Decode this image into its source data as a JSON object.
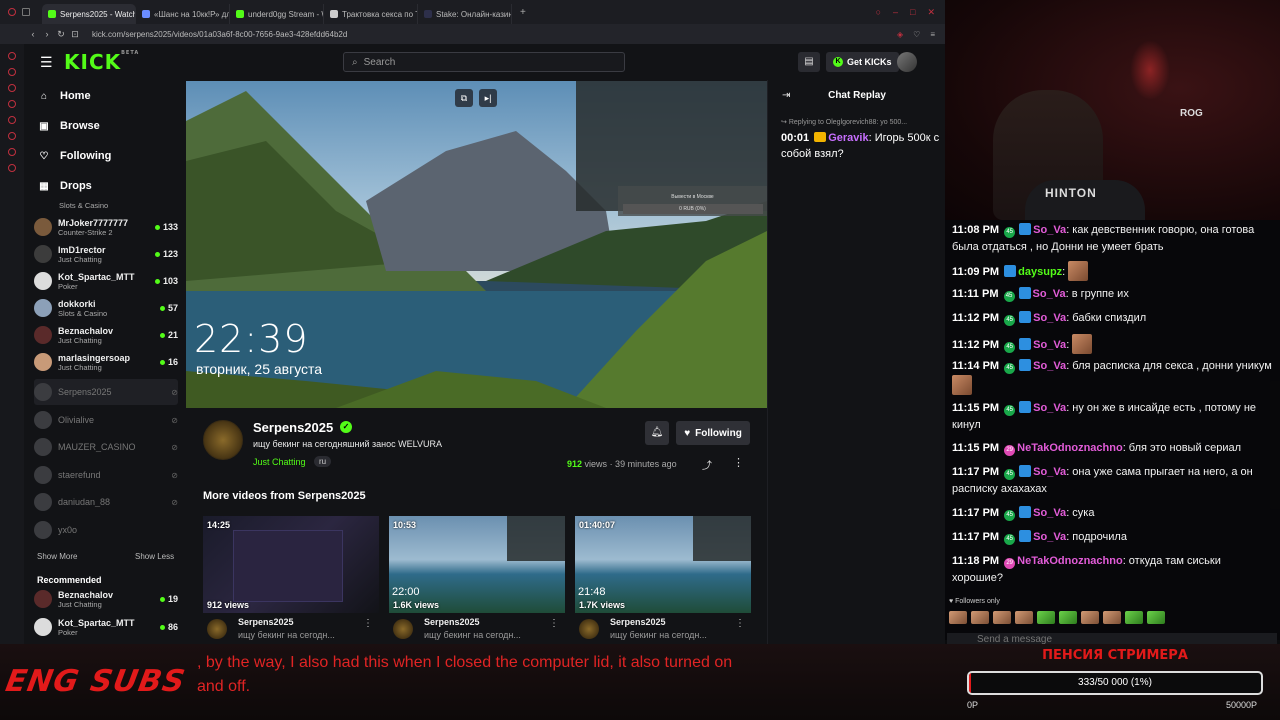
{
  "browser": {
    "tabs": [
      {
        "label": "Serpens2025 - Watch",
        "color": "#53fc18",
        "active": true
      },
      {
        "label": "«Шанс на 10кк!Р» для зрит",
        "color": "#6a8cff",
        "active": false
      },
      {
        "label": "underd0gg Stream - Watc",
        "color": "#53fc18",
        "active": false
      },
      {
        "label": "Трактовка секса по Таро",
        "color": "#cccccc",
        "active": false
      },
      {
        "label": "Stake: Онлайн-казино и с",
        "color": "#2d2f4a",
        "active": false
      }
    ],
    "new_tab": "+",
    "url": "kick.com/serpens2025/videos/01a03a6f-8c00-7656-9ae3-428efdd64b2d"
  },
  "header": {
    "logo": "KICK",
    "logo_sup": "BETA",
    "search_placeholder": "Search",
    "get_kicks": "Get KICKs"
  },
  "sidebar": {
    "nav": [
      {
        "label": "Home",
        "icon": "home-icon"
      },
      {
        "label": "Browse",
        "icon": "browse-icon"
      },
      {
        "label": "Following",
        "icon": "heart-icon"
      },
      {
        "label": "Drops",
        "icon": "drops-icon"
      }
    ],
    "top_partial_category": "Slots & Casino",
    "channels": [
      {
        "name": "MrJoker7777777",
        "category": "Counter-Strike 2",
        "viewers": "133"
      },
      {
        "name": "ImD1rector",
        "category": "Just Chatting",
        "viewers": "123"
      },
      {
        "name": "Kot_Spartac_MTT",
        "category": "Poker",
        "viewers": "103"
      },
      {
        "name": "dokkorki",
        "category": "Slots & Casino",
        "viewers": "57"
      },
      {
        "name": "Beznachalov",
        "category": "Just Chatting",
        "viewers": "21"
      },
      {
        "name": "marlasingersoap",
        "category": "Just Chatting",
        "viewers": "16"
      }
    ],
    "offline": [
      "Serpens2025",
      "Olivialive",
      "MAUZER_CASINO",
      "staerefund",
      "daniudan_88",
      "yx0o"
    ],
    "show_more": "Show More",
    "show_less": "Show Less",
    "recommended_title": "Recommended",
    "recommended": [
      {
        "name": "Beznachalov",
        "category": "Just Chatting",
        "viewers": "19"
      },
      {
        "name": "Kot_Spartac_MTT",
        "category": "Poker",
        "viewers": "86"
      }
    ]
  },
  "player": {
    "time": "22:39",
    "date": "вторник, 25 августа",
    "overlay_line1": "Вывести в Москве",
    "overlay_line2": "0 RUB (0%)"
  },
  "stream": {
    "channel": "Serpens2025",
    "title": "ищу бекинг на сегодняшний занос WELVURA",
    "category": "Just Chatting",
    "language": "ru",
    "follow_label": "Following",
    "views_count": "912",
    "views_word": " views",
    "ago": "· 39 minutes ago",
    "more_videos_title": "More videos from Serpens2025"
  },
  "videos": [
    {
      "duration": "14:25",
      "views": "912 views",
      "channel": "Serpens2025",
      "title": "ищу бекинг на сегодн..."
    },
    {
      "duration": "10:53",
      "views": "1.6K views",
      "channel": "Serpens2025",
      "title": "ищу бекинг на сегодн..."
    },
    {
      "duration": "01:40:07",
      "views": "1.7K views",
      "channel": "Serpens2025",
      "title": "ищу бекинг на сегодн..."
    }
  ],
  "chat_replay": {
    "title": "Chat Replay",
    "reply_to": "Replying to Oleglgorevich88: yo 500...",
    "time": "00:01",
    "user": "Geravik",
    "text": ": Игорь 500к с собой взял?"
  },
  "webcam": {
    "shirt_text": "HINTON",
    "rog": "ROG"
  },
  "overlay_chat": {
    "messages": [
      {
        "time": "11:08 PM",
        "badge": "45",
        "user": "So_Va",
        "text": ": как девственник говорю, она готова была отдаться , но Донни не умеет брать"
      },
      {
        "time": "11:09 PM",
        "badge": "",
        "user": "daysupz",
        "text": ":"
      },
      {
        "time": "11:11 PM",
        "badge": "45",
        "user": "So_Va",
        "text": ": в группе их"
      },
      {
        "time": "11:12 PM",
        "badge": "45",
        "user": "So_Va",
        "text": ": бабки спиздил"
      },
      {
        "time": "11:12 PM",
        "badge": "45",
        "user": "So_Va",
        "text": ":"
      },
      {
        "time": "11:14 PM",
        "badge": "45",
        "user": "So_Va",
        "text": ": бля расписка для секса , донни уникум"
      },
      {
        "time": "11:15 PM",
        "badge": "45",
        "user": "So_Va",
        "text": ": ну он же в инсайде есть , потому не кинул"
      },
      {
        "time": "11:15 PM",
        "badge": "29",
        "user": "NeTakOdnoznachno",
        "text": ": бля это новый сериал"
      },
      {
        "time": "11:17 PM",
        "badge": "45",
        "user": "So_Va",
        "text": ": она уже сама прыгает на него, а он расписку ахахахах"
      },
      {
        "time": "11:17 PM",
        "badge": "45",
        "user": "So_Va",
        "text": ": сука"
      },
      {
        "time": "11:17 PM",
        "badge": "45",
        "user": "So_Va",
        "text": ": подрочила"
      },
      {
        "time": "11:18 PM",
        "badge": "29",
        "user": "NeTakOdnoznachno",
        "text": ": откуда там сиськи хорошие?"
      }
    ],
    "followers_only": "Followers only",
    "message_placeholder": "Send a message"
  },
  "bottom": {
    "eng_subs": "ENG SUBS",
    "subtitle": ", by the way, I also had this when I closed the computer lid, it also turned on and off.",
    "pension_title": "ПЕНСИЯ СТРИМЕРА",
    "pension_text": "333/50 000 (1%)",
    "pension_fraction": 0.0067,
    "pension_min": "0Р",
    "pension_max": "50000Р"
  },
  "colors": {
    "kick_green": "#53fc18",
    "subtitle_red": "#e02424",
    "username_pink": "#e25cd8"
  }
}
